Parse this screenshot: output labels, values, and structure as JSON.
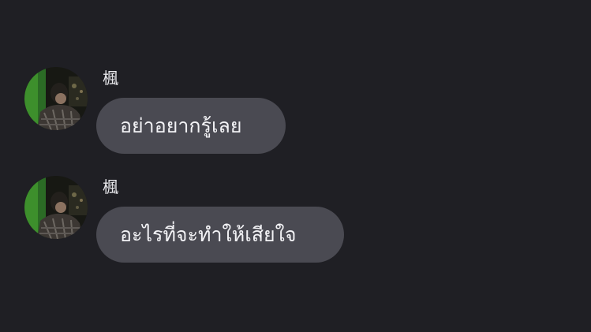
{
  "messages": [
    {
      "sender": "楓",
      "avatar_icon": "profile-photo",
      "text": "อย่าอยากรู้เลย"
    },
    {
      "sender": "楓",
      "avatar_icon": "profile-photo",
      "text": "อะไรที่จะทำให้เสียใจ"
    }
  ],
  "colors": {
    "background": "#1f1f24",
    "bubble": "#4a4a52",
    "text": "#f2f2f5",
    "avatar_accent": "#3d8f2c"
  }
}
